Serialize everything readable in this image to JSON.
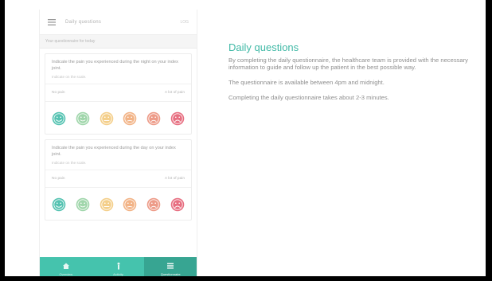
{
  "app": {
    "topbar_title": "Daily questions",
    "topbar_extra": "LOG",
    "section_header": "Your questionnaire for today"
  },
  "questions": [
    {
      "title": "Indicate the pain you experienced during the night on your index joint.",
      "hint": "Indicate on the scale.",
      "scale_left": "No pain",
      "scale_right": "A lot of pain"
    },
    {
      "title": "Indicate the pain you experienced during the day on your index joint.",
      "hint": "Indicate on the scale.",
      "scale_left": "No pain",
      "scale_right": "A lot of pain"
    }
  ],
  "faces": [
    {
      "name": "very-happy-face-icon",
      "color": "#38b8a5"
    },
    {
      "name": "happy-face-icon",
      "color": "#8fcf9c"
    },
    {
      "name": "neutral-face-icon",
      "color": "#f2c777"
    },
    {
      "name": "uneasy-face-icon",
      "color": "#f0a671"
    },
    {
      "name": "sad-face-icon",
      "color": "#ea8a73"
    },
    {
      "name": "very-sad-face-icon",
      "color": "#e3566b"
    }
  ],
  "tabs": [
    {
      "label": "Overview",
      "icon": "home-icon"
    },
    {
      "label": "Activity",
      "icon": "person-icon"
    },
    {
      "label": "Questionnaire",
      "icon": "list-icon"
    }
  ],
  "info": {
    "title": "Daily questions",
    "paragraphs": [
      "By completing the daily questionnaire, the healthcare team is provided with the necessary information to guide and follow up the patient in the best possible way.",
      "The questionnaire is available between 4pm and midnight.",
      "Completing the daily questionnaire takes about 2-3 minutes."
    ]
  },
  "colors": {
    "accent": "#40b9a6",
    "tabbar": "#45c3ad",
    "tab_active": "#37a592"
  }
}
